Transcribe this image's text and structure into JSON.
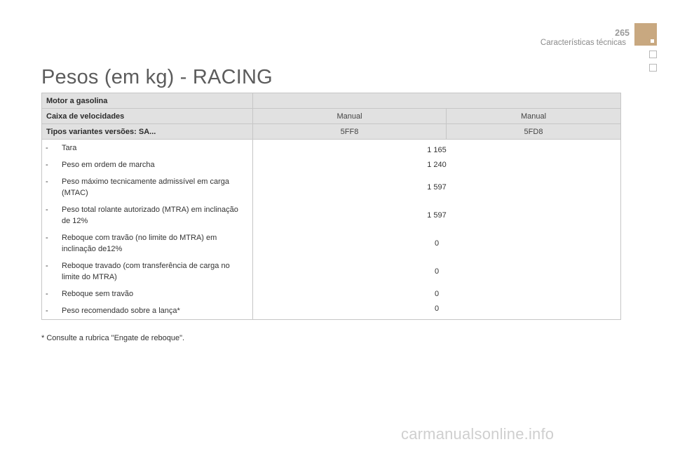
{
  "header": {
    "page_number": "265",
    "section_title": "Características técnicas"
  },
  "title": "Pesos (em kg) - RACING",
  "table": {
    "engine_label": "Motor a gasolina",
    "gearbox_label": "Caixa de velocidades",
    "gearbox_values": [
      "Manual",
      "Manual"
    ],
    "variants_label": "Tipos variantes versões: SA...",
    "variants_values": [
      "5FF8",
      "5FD8"
    ],
    "rows": [
      {
        "label": "Tara",
        "value": "1 165"
      },
      {
        "label": "Peso em ordem de marcha",
        "value": "1 240"
      },
      {
        "label": "Peso máximo tecnicamente admissível em carga (MTAC)",
        "value": "1 597"
      },
      {
        "label": "Peso total rolante autorizado (MTRA) em inclinação de 12%",
        "value": "1 597"
      },
      {
        "label": "Reboque com travão (no limite do MTRA) em inclinação de12%",
        "value": "0"
      },
      {
        "label": "Reboque travado (com transferência de carga no limite do MTRA)",
        "value": "0"
      },
      {
        "label": "Reboque sem travão",
        "value": "0"
      },
      {
        "label": "Peso recomendado sobre a lança*",
        "value": "0"
      }
    ]
  },
  "footnote": "* Consulte a rubrica \"Engate de reboque\".",
  "watermark": "carmanualsonline.info"
}
